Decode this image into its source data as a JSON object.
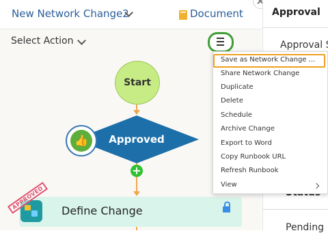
{
  "header": {
    "title": "New Network Change2",
    "document_label": "Document"
  },
  "toolbar": {
    "select_action_label": "Select Action"
  },
  "flow": {
    "start_label": "Start",
    "decision_label": "Approved",
    "step_label": "Define Change",
    "stamp_text": "APPROVED"
  },
  "right_panel": {
    "tab_label": "Approval",
    "approval_status_label": "Approval S",
    "status_label": "Status",
    "status_value": "Pending"
  },
  "menu": {
    "items": [
      "Save as Network Change ...",
      "Share Network Change",
      "Duplicate",
      "Delete",
      "Schedule",
      "Archive Change",
      "Export to Word",
      "Copy Runbook URL",
      "Refresh Runbook",
      "View"
    ],
    "highlighted_index": 0
  },
  "colors": {
    "title_blue": "#2a5d9a",
    "start_green": "#c7ec86",
    "decision_blue": "#1c6fa8",
    "step_teal": "#d9f4ea",
    "connector_orange": "#f0a64a",
    "highlight_orange": "#f0a020",
    "menu_button_green": "#3f9d36"
  }
}
